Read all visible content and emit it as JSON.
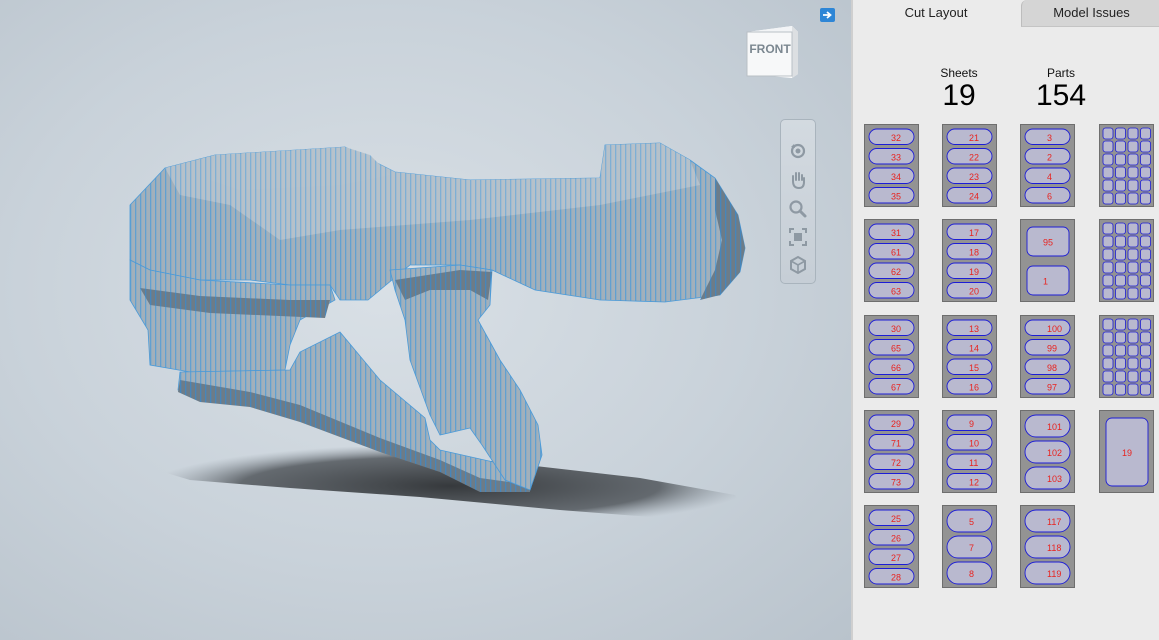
{
  "viewport": {
    "viewcube_label": "FRONT",
    "nav_tools": [
      {
        "name": "orbit-icon"
      },
      {
        "name": "pan-hand-icon"
      },
      {
        "name": "zoom-icon"
      },
      {
        "name": "fit-to-view-icon"
      },
      {
        "name": "home-cube-icon"
      }
    ],
    "colors": {
      "slice_edge": "#4a9ad8",
      "model_fill": "#9aa9b5",
      "background": "#c9d2da"
    }
  },
  "panel": {
    "tabs": [
      {
        "label": "Cut Layout",
        "active": true
      },
      {
        "label": "Model Issues",
        "active": false
      }
    ],
    "stats": {
      "sheets_label": "Sheets",
      "sheets_value": "19",
      "parts_label": "Parts",
      "parts_value": "154"
    },
    "sheets": [
      {
        "index": 1,
        "labels": [
          "32",
          "33",
          "34",
          "35"
        ]
      },
      {
        "index": 2,
        "labels": [
          "21",
          "22",
          "23",
          "24"
        ]
      },
      {
        "index": 3,
        "labels": [
          "3",
          "2",
          "4",
          "6"
        ]
      },
      {
        "index": 4,
        "labels": []
      },
      {
        "index": 5,
        "labels": [
          "31",
          "61",
          "62",
          "63"
        ]
      },
      {
        "index": 6,
        "labels": [
          "17",
          "18",
          "19",
          "20"
        ]
      },
      {
        "index": 7,
        "labels": [
          "95",
          "1"
        ]
      },
      {
        "index": 8,
        "labels": []
      },
      {
        "index": 9,
        "labels": [
          "30",
          "65",
          "66",
          "67"
        ]
      },
      {
        "index": 10,
        "labels": [
          "13",
          "14",
          "15",
          "16"
        ]
      },
      {
        "index": 11,
        "labels": [
          "100",
          "99",
          "98",
          "97"
        ]
      },
      {
        "index": 12,
        "labels": []
      },
      {
        "index": 13,
        "labels": [
          "29",
          "71",
          "72",
          "73"
        ]
      },
      {
        "index": 14,
        "labels": [
          "9",
          "10",
          "11",
          "12"
        ]
      },
      {
        "index": 15,
        "labels": [
          "101",
          "102",
          "103"
        ]
      },
      {
        "index": 16,
        "labels": [
          "19"
        ]
      },
      {
        "index": 17,
        "labels": [
          "25",
          "26",
          "27",
          "28"
        ]
      },
      {
        "index": 18,
        "labels": [
          "5",
          "7",
          "8"
        ]
      },
      {
        "index": 19,
        "labels": [
          "117",
          "118",
          "119"
        ]
      }
    ],
    "colors": {
      "sheet_bg": "#939393",
      "part_fill": "#b9b9cf",
      "part_outline": "#1d1dd6",
      "label": "#e8231f"
    }
  }
}
